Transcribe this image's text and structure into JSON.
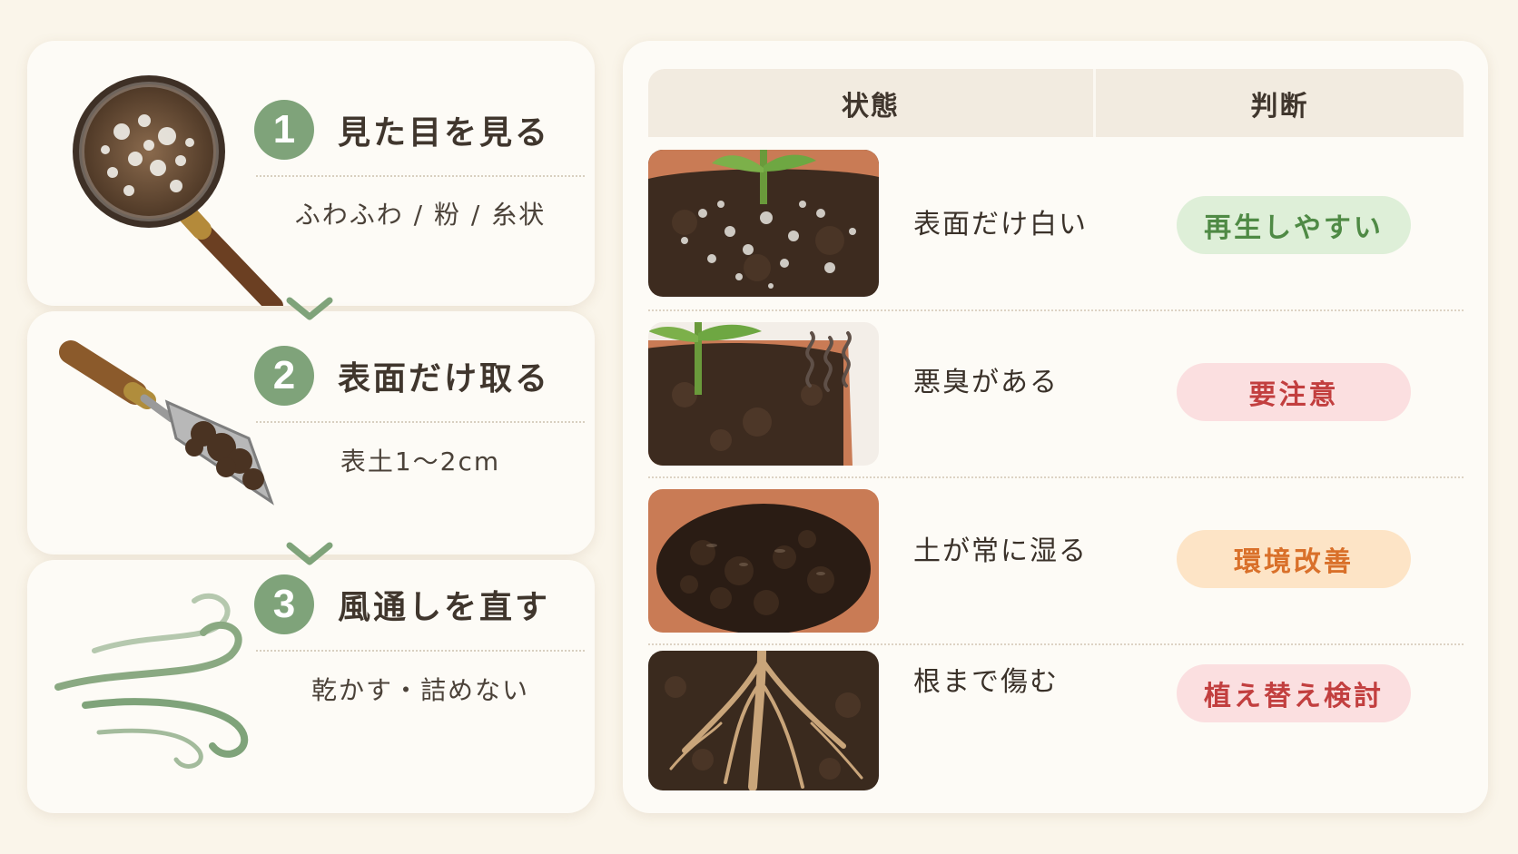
{
  "steps": [
    {
      "number": "1",
      "title": "見た目を見る",
      "subtitle": "ふわふわ / 粉 / 糸状",
      "illustration": "magnifying-glass-mold"
    },
    {
      "number": "2",
      "title": "表面だけ取る",
      "subtitle": "表土1～2cm",
      "illustration": "trowel-with-soil"
    },
    {
      "number": "3",
      "title": "風通しを直す",
      "subtitle": "乾かす・詰めない",
      "illustration": "wind-swirl"
    }
  ],
  "table": {
    "headers": {
      "state": "状態",
      "judgment": "判断"
    },
    "rows": [
      {
        "state": "表面だけ白い",
        "judgment": "再生しやすい",
        "photo": "white-mold-on-soil",
        "pill_bg": "#deefd8",
        "pill_fg": "#4f8a45"
      },
      {
        "state": "悪臭がある",
        "judgment": "要注意",
        "photo": "smelly-pot-with-fumes",
        "pill_bg": "#fbdfe0",
        "pill_fg": "#c23f3f"
      },
      {
        "state": "土が常に湿る",
        "judgment": "環境改善",
        "photo": "waterlogged-soil",
        "pill_bg": "#fde4c6",
        "pill_fg": "#d9702a"
      },
      {
        "state": "根まで傷む",
        "judgment": "植え替え検討",
        "photo": "damaged-roots",
        "pill_bg": "#fbdfe0",
        "pill_fg": "#c23f3f"
      }
    ]
  },
  "colors": {
    "page_bg": "#faf5ea",
    "card_bg": "#fdfbf6",
    "badge_green": "#7fa37a",
    "header_bg": "#f2ebe0"
  }
}
